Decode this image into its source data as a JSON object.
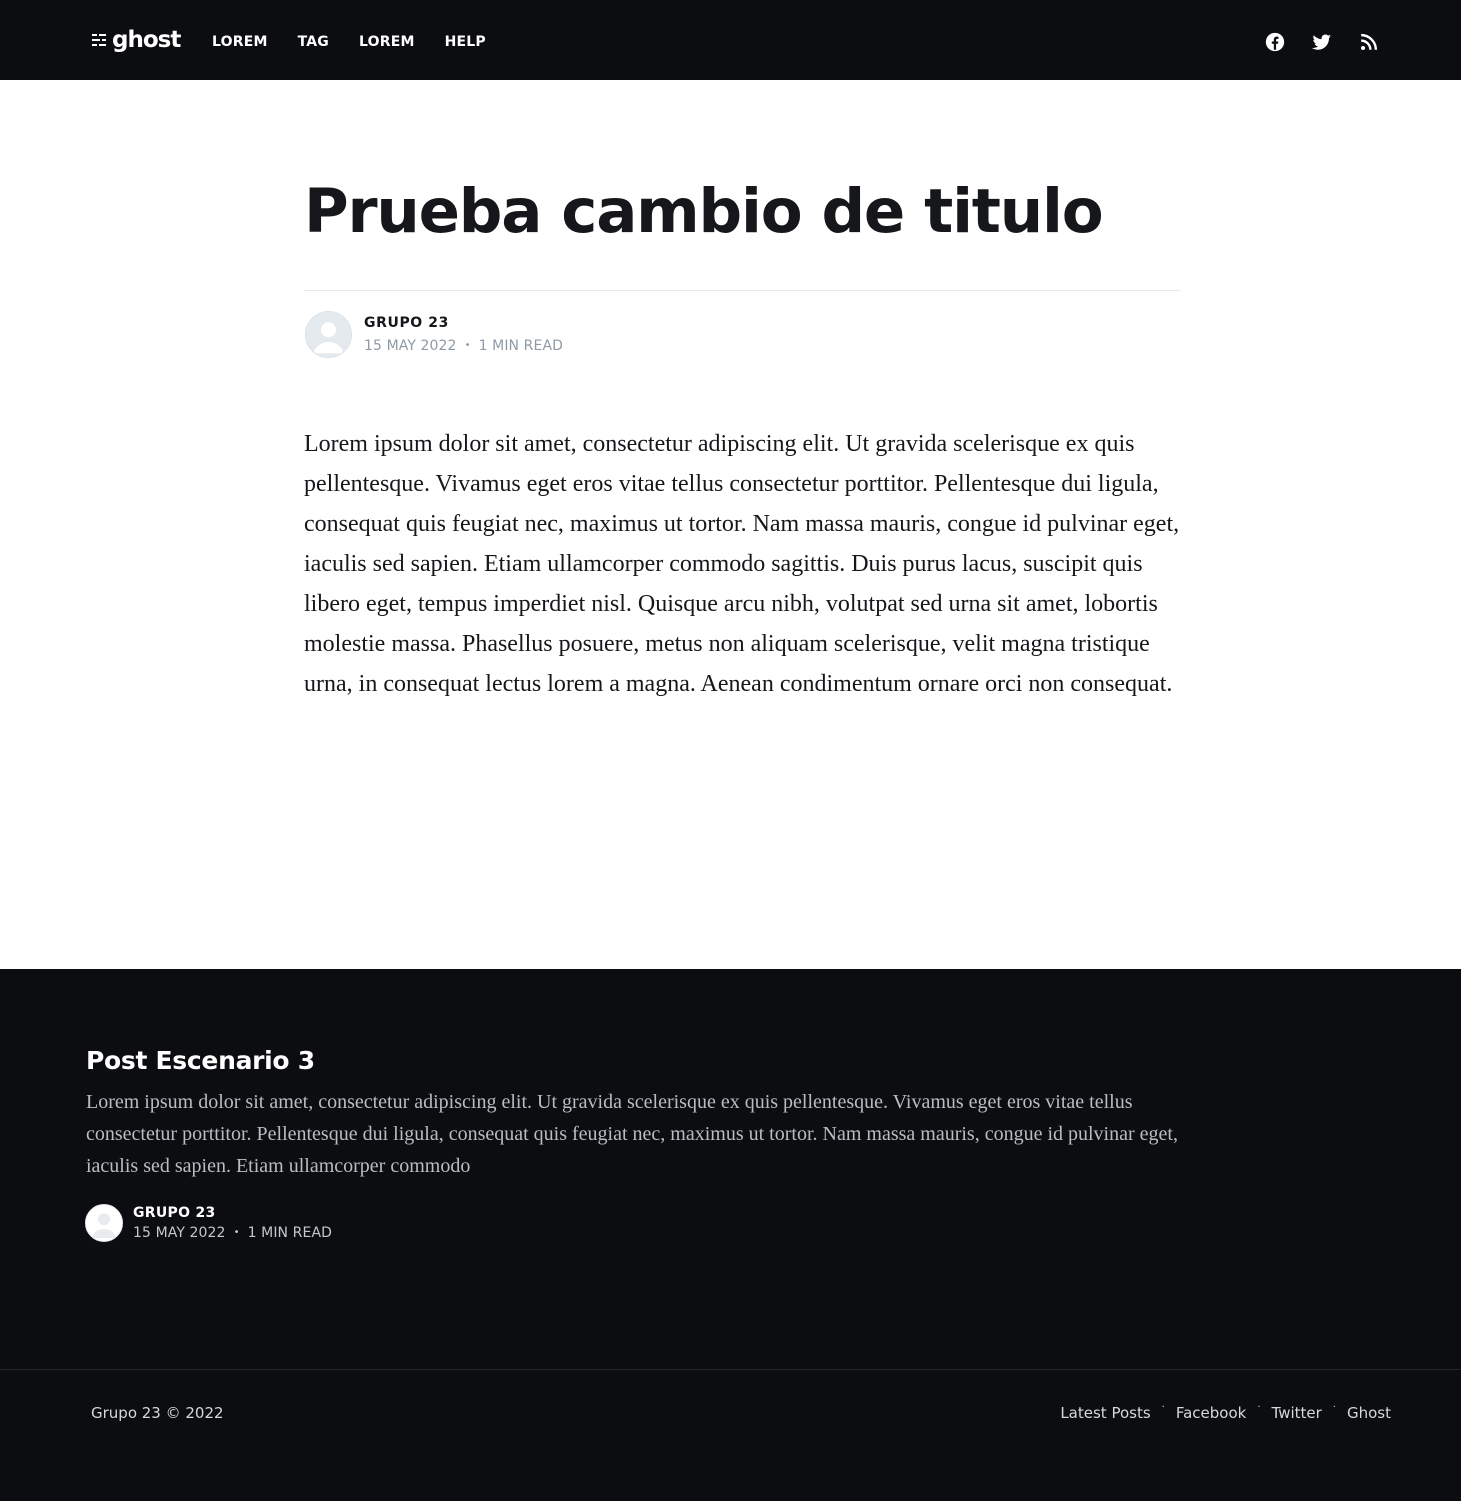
{
  "header": {
    "logo_text": "ghost",
    "nav": [
      {
        "label": "LOREM"
      },
      {
        "label": "TAG"
      },
      {
        "label": "LOREM"
      },
      {
        "label": "HELP"
      }
    ],
    "social_icons": [
      "facebook-icon",
      "twitter-icon",
      "rss-icon"
    ]
  },
  "post": {
    "title": "Prueba cambio de titulo",
    "author": "GRUPO 23",
    "date": "15 MAY 2022",
    "separator": "•",
    "reading_time": "1 MIN READ",
    "body": "Lorem ipsum dolor sit amet, consectetur adipiscing elit. Ut gravida scelerisque ex quis pellentesque. Vivamus eget eros vitae tellus consectetur porttitor. Pellentesque dui ligula, consequat quis feugiat nec, maximus ut tortor. Nam massa mauris, congue id pulvinar eget, iaculis sed sapien. Etiam ullamcorper commodo sagittis. Duis purus lacus, suscipit quis libero eget, tempus imperdiet nisl. Quisque arcu nibh, volutpat sed urna sit amet, lobortis molestie massa. Phasellus posuere, metus non aliquam scelerisque, velit magna tristique urna, in consequat lectus lorem a magna. Aenean condimentum ornare orci non consequat."
  },
  "read_next": {
    "title": "Post Escenario 3",
    "excerpt": "Lorem ipsum dolor sit amet, consectetur adipiscing elit. Ut gravida scelerisque ex quis pellentesque. Vivamus eget eros vitae tellus consectetur porttitor. Pellentesque dui ligula, consequat quis feugiat nec, maximus ut tortor. Nam massa mauris, congue id pulvinar eget, iaculis sed sapien. Etiam ullamcorper commodo",
    "author": "GRUPO 23",
    "date": "15 MAY 2022",
    "separator": "•",
    "reading_time": "1 MIN READ"
  },
  "footer": {
    "copyright": "Grupo 23 © 2022",
    "links": [
      {
        "label": "Latest Posts"
      },
      {
        "label": "Facebook"
      },
      {
        "label": "Twitter"
      },
      {
        "label": "Ghost"
      }
    ],
    "separator": "·"
  },
  "colors": {
    "dark_bg": "#0c0d10",
    "text": "#15171a",
    "meta_gray": "#8e9aa5",
    "rule": "#e6e8eb"
  }
}
